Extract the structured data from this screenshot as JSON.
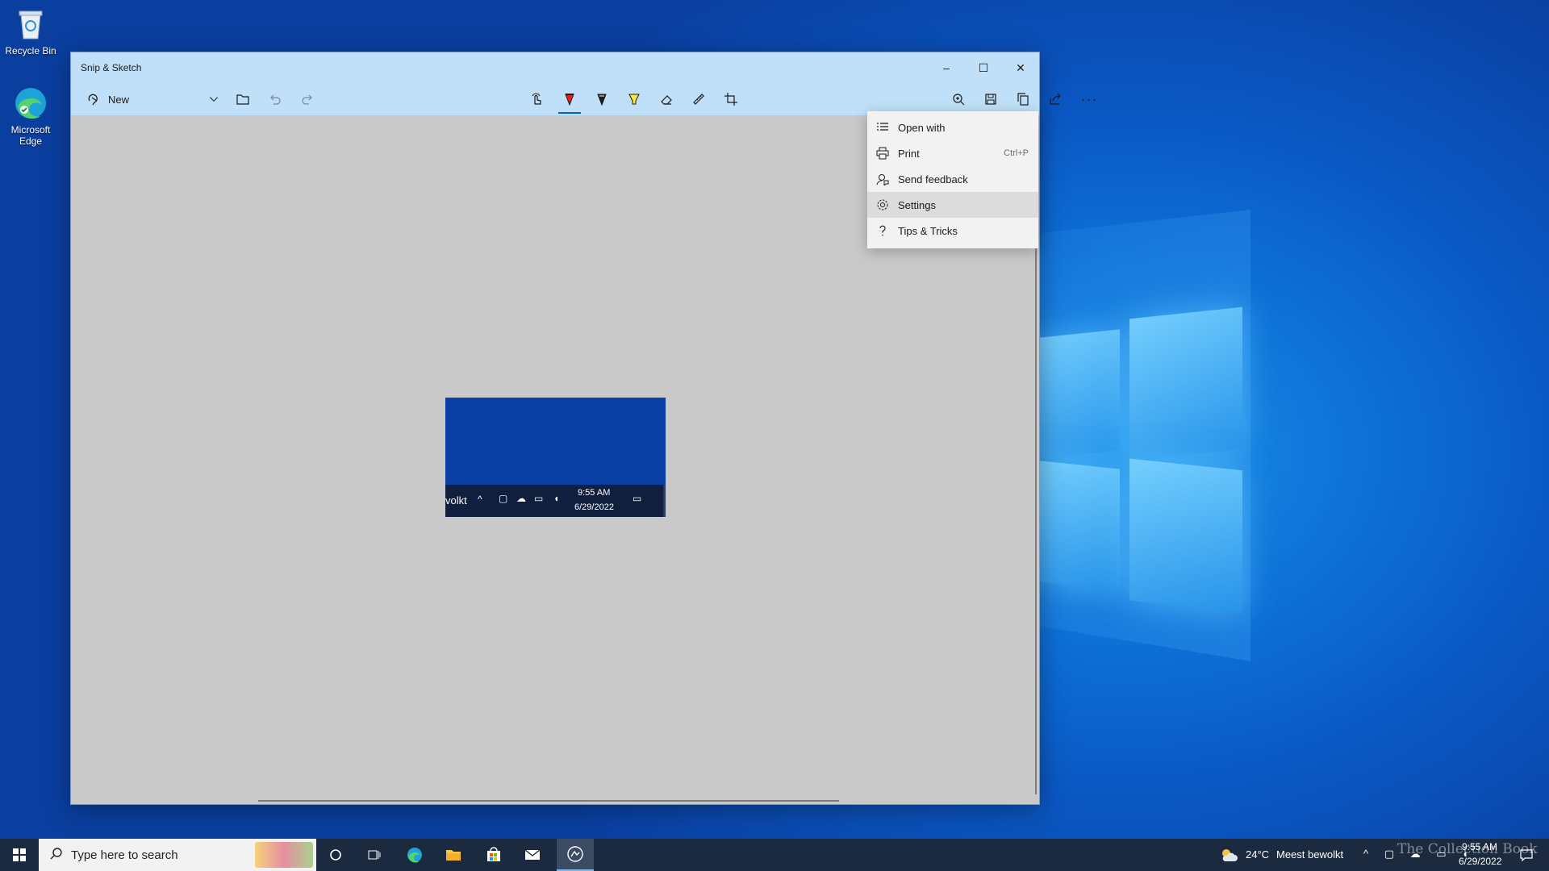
{
  "desktop": {
    "icons": [
      {
        "label": "Recycle Bin",
        "icon": "recycle-bin-icon"
      },
      {
        "label": "Microsoft Edge",
        "icon": "edge-icon"
      }
    ]
  },
  "window": {
    "title": "Snip & Sketch",
    "controls": {
      "minimize": "–",
      "maximize": "☐",
      "close": "✕"
    }
  },
  "toolbar": {
    "new_label": "New",
    "tools": [
      "touch-writing",
      "ballpoint-pen",
      "pencil",
      "highlighter",
      "eraser",
      "ruler",
      "crop"
    ],
    "right_tools": [
      "zoom",
      "save-as",
      "copy",
      "share",
      "see-more"
    ],
    "more_label": "···",
    "active_tool": "ballpoint-pen"
  },
  "snip": {
    "taskbar_text": "volkt",
    "time": "9:55 AM",
    "date": "6/29/2022"
  },
  "menu": {
    "items": [
      {
        "label": "Open with",
        "icon": "open-with-icon",
        "shortcut": ""
      },
      {
        "label": "Print",
        "icon": "printer-icon",
        "shortcut": "Ctrl+P"
      },
      {
        "label": "Send feedback",
        "icon": "feedback-icon",
        "shortcut": ""
      },
      {
        "label": "Settings",
        "icon": "gear-icon",
        "shortcut": ""
      },
      {
        "label": "Tips & Tricks",
        "icon": "question-icon",
        "shortcut": ""
      }
    ],
    "hovered": "Settings"
  },
  "taskbar": {
    "search_placeholder": "Type here to search",
    "weather_temp": "24°C",
    "weather_desc": "Meest bewolkt",
    "time": "9:55 AM",
    "date": "6/29/2022",
    "watermark": "The Collection Book"
  },
  "colors": {
    "titlebar": "#bfe0f8",
    "accent": "#0067c0",
    "canvas": "#c9c9c9",
    "taskbar": "#1c2a3f"
  }
}
